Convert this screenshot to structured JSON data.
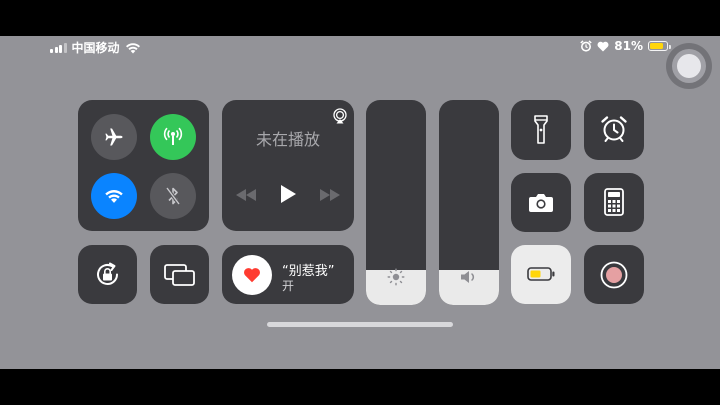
{
  "status_bar": {
    "carrier": "中国移动",
    "battery_percent": "81%",
    "battery_level": 0.81,
    "battery_color": "#ffd60a"
  },
  "connectivity": {
    "airplane": {
      "icon": "airplane-icon",
      "state": "off"
    },
    "cellular": {
      "icon": "cellular-antenna-icon",
      "state": "on",
      "color": "#34c759"
    },
    "wifi": {
      "icon": "wifi-icon",
      "state": "on",
      "color": "#0a84ff"
    },
    "bluetooth": {
      "icon": "bluetooth-off-icon",
      "state": "off"
    }
  },
  "now_playing": {
    "status": "未在播放",
    "airplay_icon": "airplay-icon",
    "controls": [
      "rewind-icon",
      "play-icon",
      "fast-forward-icon"
    ]
  },
  "brightness": {
    "level": 0.17,
    "icon": "sun-icon"
  },
  "volume": {
    "level": 0.17,
    "icon": "speaker-icon"
  },
  "toggles": {
    "rotation_lock": {
      "icon": "rotation-lock-icon"
    },
    "screen_mirroring": {
      "icon": "screen-mirroring-icon"
    },
    "do_not_disturb": {
      "title": "“别惹我”",
      "status": "开",
      "icon": "heart-icon",
      "accent": "#ff3b30"
    },
    "flashlight": {
      "icon": "flashlight-icon"
    },
    "alarm": {
      "icon": "alarm-clock-icon"
    },
    "camera": {
      "icon": "camera-icon"
    },
    "calculator": {
      "icon": "calculator-icon"
    },
    "low_power_mode": {
      "icon": "battery-icon",
      "state": "on",
      "accent": "#ffd60a"
    },
    "screen_recording": {
      "icon": "record-icon"
    }
  },
  "assistive_touch": {
    "icon": "assistive-touch-icon"
  }
}
